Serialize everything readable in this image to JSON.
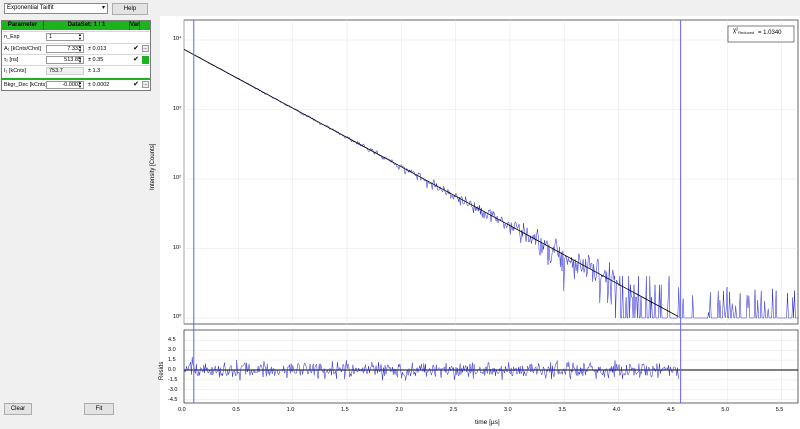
{
  "toolbar": {
    "fit_model": "Exponential Tailfit",
    "help_label": "Help"
  },
  "param_table": {
    "headers": [
      "Parameter",
      "DataSet: 1 / 1",
      "Var"
    ],
    "n_exp_label": "n_Exp",
    "n_exp_value": "1",
    "rows": [
      {
        "label": "A₁ [kCnts/Chnl]",
        "value": "7.333",
        "error": "± 0.013"
      },
      {
        "label": "τ₁ [ns]",
        "value": "513.85",
        "error": "± 0.35"
      },
      {
        "label": "I₁ [kCnts]",
        "value": "753.7",
        "error": "± 1.3"
      },
      {
        "label": "Bkgr_Dec [kCnts]",
        "value": "-0.0002",
        "error": "± 0.0002"
      }
    ]
  },
  "bottom_buttons": {
    "clear": "Clear",
    "fit": "Fit"
  },
  "chi_box": {
    "label": "χ²",
    "sublabel": "Reduced",
    "value": "= 1.0340"
  },
  "main_plot": {
    "ylabel": "Intensity [Counts]",
    "yticks": [
      "10⁴",
      "10³",
      "10²",
      "10¹",
      "10⁰"
    ]
  },
  "resid_plot": {
    "ylabel": "Resids",
    "yticks": [
      "4.5",
      "3.0",
      "1.5",
      "0.0",
      "-1.5",
      "-3.0",
      "-4.5"
    ]
  },
  "xaxis": {
    "label": "time [µs]",
    "ticks": [
      "0.0",
      "0.5",
      "1.0",
      "1.5",
      "2.0",
      "2.5",
      "3.0",
      "3.5",
      "4.0",
      "4.5",
      "5.0",
      "5.5"
    ]
  },
  "colors": {
    "accent": "#1db31d",
    "trace": "#2020d0",
    "fit": "#000000",
    "marker": "#6060ff"
  },
  "chart_data": [
    {
      "type": "line",
      "xlabel": "time [µs]",
      "ylabel": "Intensity [Counts]",
      "yscale": "log",
      "xlim": [
        0,
        5.65
      ],
      "ylim_exponent": [
        0,
        4
      ],
      "series": [],
      "decay": {
        "amplitude_counts": 7333,
        "tau_us": 0.51385,
        "start_us": 0.0,
        "end_us": 4.55,
        "x_points": [
          0.0,
          0.5,
          1.0,
          1.5,
          2.0,
          2.5,
          3.0,
          3.5,
          4.0,
          4.5
        ]
      },
      "range_markers_us": [
        0.09,
        4.57
      ]
    },
    {
      "type": "line",
      "xlabel": "time [µs]",
      "ylabel": "Resids",
      "ylim": [
        -5,
        5
      ],
      "x_end_us": 4.55
    }
  ]
}
